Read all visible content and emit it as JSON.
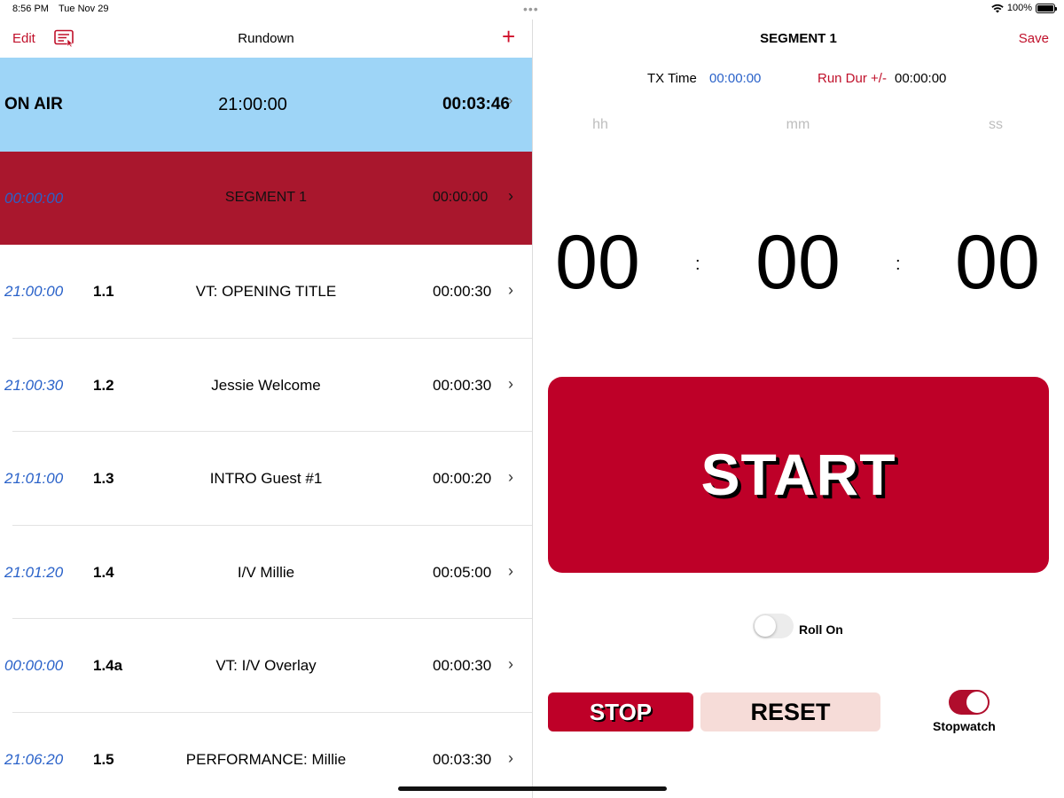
{
  "status_bar": {
    "time": "8:56 PM",
    "date": "Tue Nov 29",
    "dots": "•••",
    "battery": "100%"
  },
  "left_nav": {
    "edit_label": "Edit",
    "title": "Rundown",
    "add_label": "+",
    "script_icon": "script-list-icon"
  },
  "on_air": {
    "label": "ON AIR",
    "time": "21:00:00",
    "remaining": "00:03:46",
    "chevron": "›"
  },
  "segment": {
    "tx": "00:00:00",
    "name": "SEGMENT 1",
    "duration": "00:00:00",
    "chevron": "›"
  },
  "items": [
    {
      "tx": "21:00:00",
      "num": "1.1",
      "title": "VT: OPENING TITLE",
      "duration": "00:00:30",
      "chevron": "›"
    },
    {
      "tx": "21:00:30",
      "num": "1.2",
      "title": "Jessie Welcome",
      "duration": "00:00:30",
      "chevron": "›"
    },
    {
      "tx": "21:01:00",
      "num": "1.3",
      "title": "INTRO Guest #1",
      "duration": "00:00:20",
      "chevron": "›"
    },
    {
      "tx": "21:01:20",
      "num": "1.4",
      "title": "I/V Millie",
      "duration": "00:05:00",
      "chevron": "›"
    },
    {
      "tx": "00:00:00",
      "num": "1.4a",
      "title": "VT:  I/V Overlay",
      "duration": "00:00:30",
      "chevron": "›"
    },
    {
      "tx": "21:06:20",
      "num": "1.5",
      "title": "PERFORMANCE: Millie",
      "duration": "00:03:30",
      "chevron": "›"
    }
  ],
  "detail": {
    "title": "SEGMENT 1",
    "save_label": "Save",
    "tx_label": "TX Time",
    "tx_value": "00:00:00",
    "rundur_label": "Run Dur +/-",
    "rundur_value": "00:00:00",
    "units": {
      "hh": "hh",
      "mm": "mm",
      "ss": "ss"
    },
    "digits": {
      "hh": "00",
      "mm": "00",
      "ss": "00"
    },
    "colon": ":",
    "start_label": "START",
    "rollon_label": "Roll On",
    "rollon_on": false,
    "stop_label": "STOP",
    "reset_label": "RESET",
    "stopwatch_label": "Stopwatch",
    "stopwatch_on": true
  },
  "colors": {
    "accent": "#c0102a",
    "on_air_bg": "#9ed5f7",
    "segment_bg": "#a9172d",
    "start_bg": "#be0028",
    "tx_blue": "#2a62c9",
    "reset_bg": "#f6dcd8"
  }
}
